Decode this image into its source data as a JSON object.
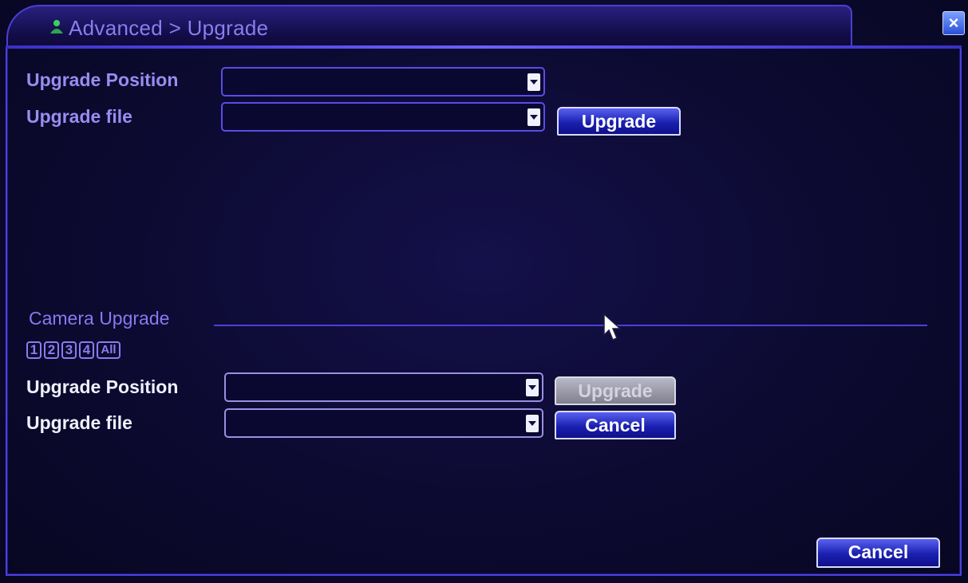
{
  "window": {
    "title": "Advanced > Upgrade",
    "close_label": "×"
  },
  "upgrade": {
    "position_label": "Upgrade Position",
    "position_value": "",
    "file_label": "Upgrade file",
    "file_value": "",
    "upgrade_button": "Upgrade"
  },
  "camera_upgrade": {
    "section_title": "Camera Upgrade",
    "channels": [
      "1",
      "2",
      "3",
      "4",
      "All"
    ],
    "position_label": "Upgrade Position",
    "position_value": "",
    "file_label": "Upgrade file",
    "file_value": "",
    "upgrade_button": "Upgrade",
    "cancel_button": "Cancel"
  },
  "footer": {
    "cancel_button": "Cancel"
  },
  "icons": {
    "title_icon": "person-icon",
    "close_icon": "close-icon",
    "dropdown_icon": "chevron-down-icon",
    "cursor_icon": "mouse-pointer-icon"
  },
  "colors": {
    "accent": "#4c40e0",
    "label": "#9a8cf0",
    "button": "#1a20b0"
  }
}
